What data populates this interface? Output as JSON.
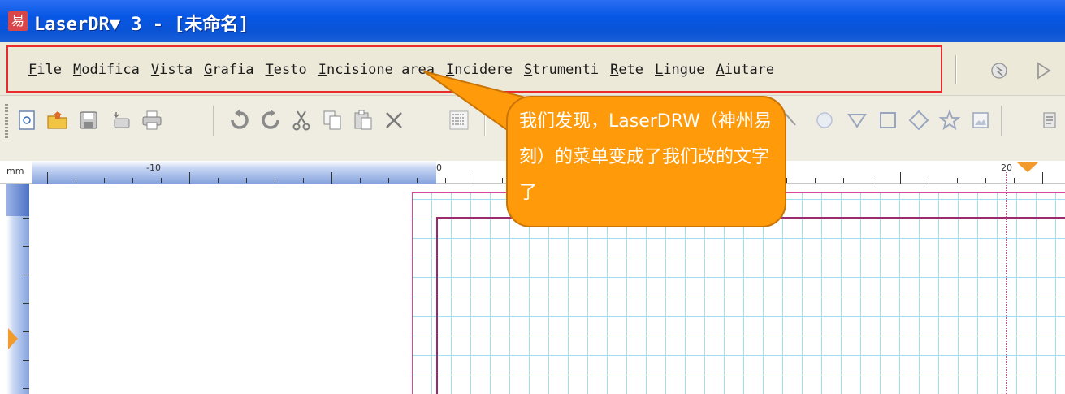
{
  "window": {
    "app_logo_glyph": "易",
    "title": "LaserDR▼ 3 - [未命名]"
  },
  "menu": {
    "items": [
      {
        "key": "F",
        "rest": "ile"
      },
      {
        "key": "M",
        "rest": "odifica"
      },
      {
        "key": "V",
        "rest": "ista"
      },
      {
        "key": "G",
        "rest": "rafia"
      },
      {
        "key": "T",
        "rest": "esto"
      },
      {
        "key": "I",
        "rest": "ncisione area"
      },
      {
        "key": "I",
        "rest": "ncidere"
      },
      {
        "key": "S",
        "rest": "trumenti"
      },
      {
        "key": "R",
        "rest": "ete"
      },
      {
        "key": "L",
        "rest": "ingue"
      },
      {
        "key": "A",
        "rest": "iutare"
      }
    ],
    "right_icons": [
      "engrave-icon",
      "play-icon"
    ]
  },
  "toolbar": {
    "icons": [
      "new-file-icon",
      "open-folder-icon",
      "save-icon",
      "import-icon",
      "print-icon",
      "undo-icon",
      "redo-icon",
      "cut-icon",
      "copy-icon",
      "paste-icon",
      "delete-icon",
      "barcode-icon",
      "line-icon",
      "circle-icon",
      "triangle-icon",
      "square-icon",
      "diamond-icon",
      "star-icon",
      "image-icon",
      "more-icon"
    ]
  },
  "callout": {
    "text": "我们发现，LaserDRW（神州易刻）的菜单变成了我们改的文字了"
  },
  "ruler": {
    "unit": "mm",
    "labels": [
      "-10",
      "0",
      "20"
    ]
  },
  "colors": {
    "titlebar": "#0756e4",
    "menu_outline": "#e82b2b",
    "callout_fill": "#ff9a0a",
    "grid_line": "#a4dff0",
    "page_border": "#d9489c"
  }
}
